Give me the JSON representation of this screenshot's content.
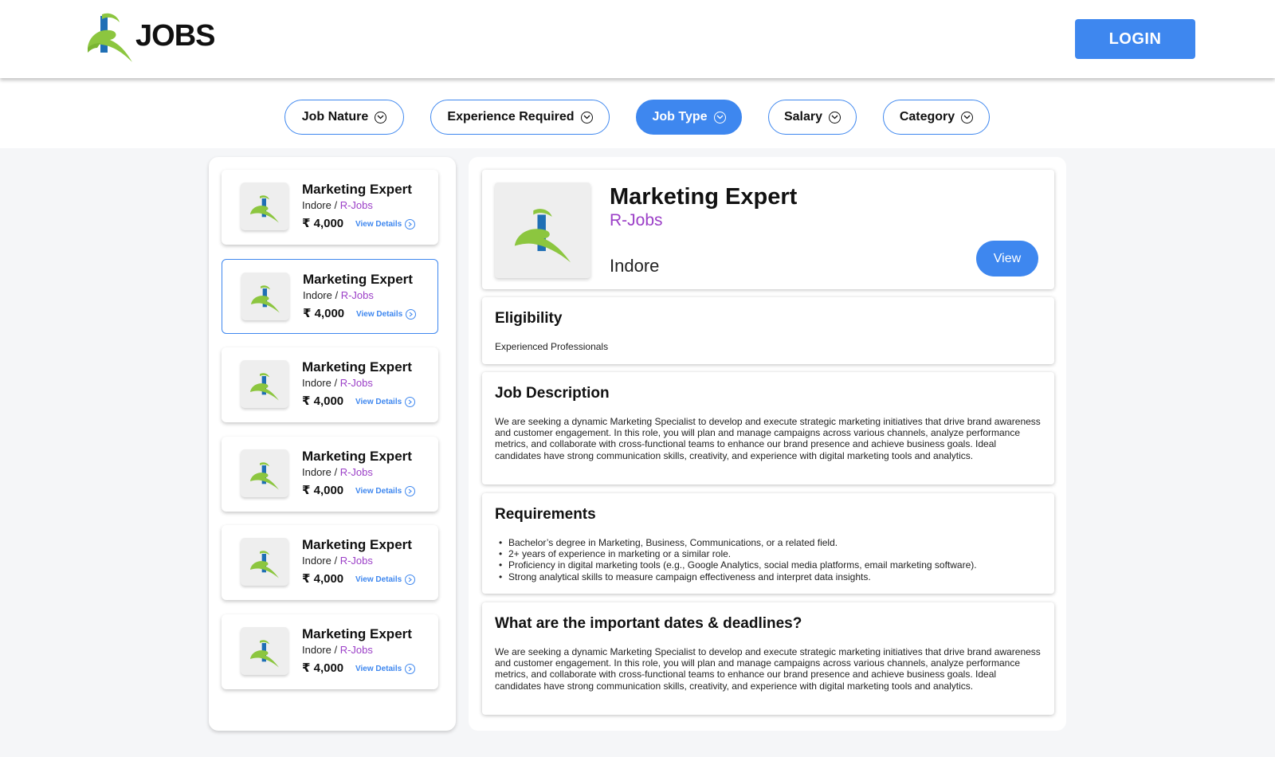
{
  "header": {
    "logo_text": "JOBS",
    "login_label": "LOGIN"
  },
  "filters": [
    {
      "label": "Job Nature",
      "active": false
    },
    {
      "label": "Experience Required",
      "active": false
    },
    {
      "label": "Job Type",
      "active": true
    },
    {
      "label": "Salary",
      "active": false
    },
    {
      "label": "Category",
      "active": false
    }
  ],
  "jobs": [
    {
      "title": "Marketing Expert",
      "location": "Indore",
      "separator": " / ",
      "company": "R-Jobs",
      "salary": "₹ 4,000",
      "link": "View Details",
      "selected": false
    },
    {
      "title": "Marketing Expert",
      "location": "Indore",
      "separator": " / ",
      "company": "R-Jobs",
      "salary": "₹ 4,000",
      "link": "View Details",
      "selected": true
    },
    {
      "title": "Marketing Expert",
      "location": "Indore",
      "separator": " / ",
      "company": "R-Jobs",
      "salary": "₹ 4,000",
      "link": "View Details",
      "selected": false
    },
    {
      "title": "Marketing Expert",
      "location": "Indore",
      "separator": " / ",
      "company": "R-Jobs",
      "salary": "₹ 4,000",
      "link": "View Details",
      "selected": false
    },
    {
      "title": "Marketing Expert",
      "location": "Indore",
      "separator": " / ",
      "company": "R-Jobs",
      "salary": "₹ 4,000",
      "link": "View Details",
      "selected": false
    },
    {
      "title": "Marketing Expert",
      "location": "Indore",
      "separator": " / ",
      "company": "R-Jobs",
      "salary": "₹ 4,000",
      "link": "View Details",
      "selected": false
    }
  ],
  "detail": {
    "title": "Marketing Expert",
    "company": "R-Jobs",
    "location": "Indore",
    "view_label": "View",
    "eligibility": {
      "title": "Eligibility",
      "text": "Experienced Professionals"
    },
    "description": {
      "title": "Job Description",
      "text": "We are seeking a dynamic Marketing Specialist to develop and execute strategic marketing initiatives that drive brand awareness and customer engagement. In this role, you will plan and manage campaigns across various channels, analyze performance metrics, and collaborate with cross-functional teams to enhance our brand presence and achieve business goals. Ideal candidates have strong communication skills, creativity, and experience with digital marketing tools and analytics."
    },
    "requirements": {
      "title": "Requirements",
      "items": [
        "Bachelor’s degree in Marketing, Business, Communications, or a related field.",
        "2+ years of experience in marketing or a similar role.",
        "Proficiency in digital marketing tools (e.g., Google Analytics, social media platforms, email marketing software).",
        "Strong analytical skills to measure campaign effectiveness and interpret data insights."
      ]
    },
    "dates": {
      "title": "What are the important dates & deadlines?",
      "text": "We are seeking a dynamic Marketing Specialist to develop and execute strategic marketing initiatives that drive brand awareness and customer engagement. In this role, you will plan and manage campaigns across various channels, analyze performance metrics, and collaborate with cross-functional teams to enhance our brand presence and achieve business goals. Ideal candidates have strong communication skills, creativity, and experience with digital marketing tools and analytics."
    }
  },
  "colors": {
    "accent": "#3e87ef",
    "company": "#9b3fc7",
    "logo_green": "#8cc63f",
    "logo_blue": "#1f6fb5"
  },
  "icons": [
    "r-jobs-logo-icon",
    "chevron-down-icon",
    "chevron-right-icon"
  ]
}
